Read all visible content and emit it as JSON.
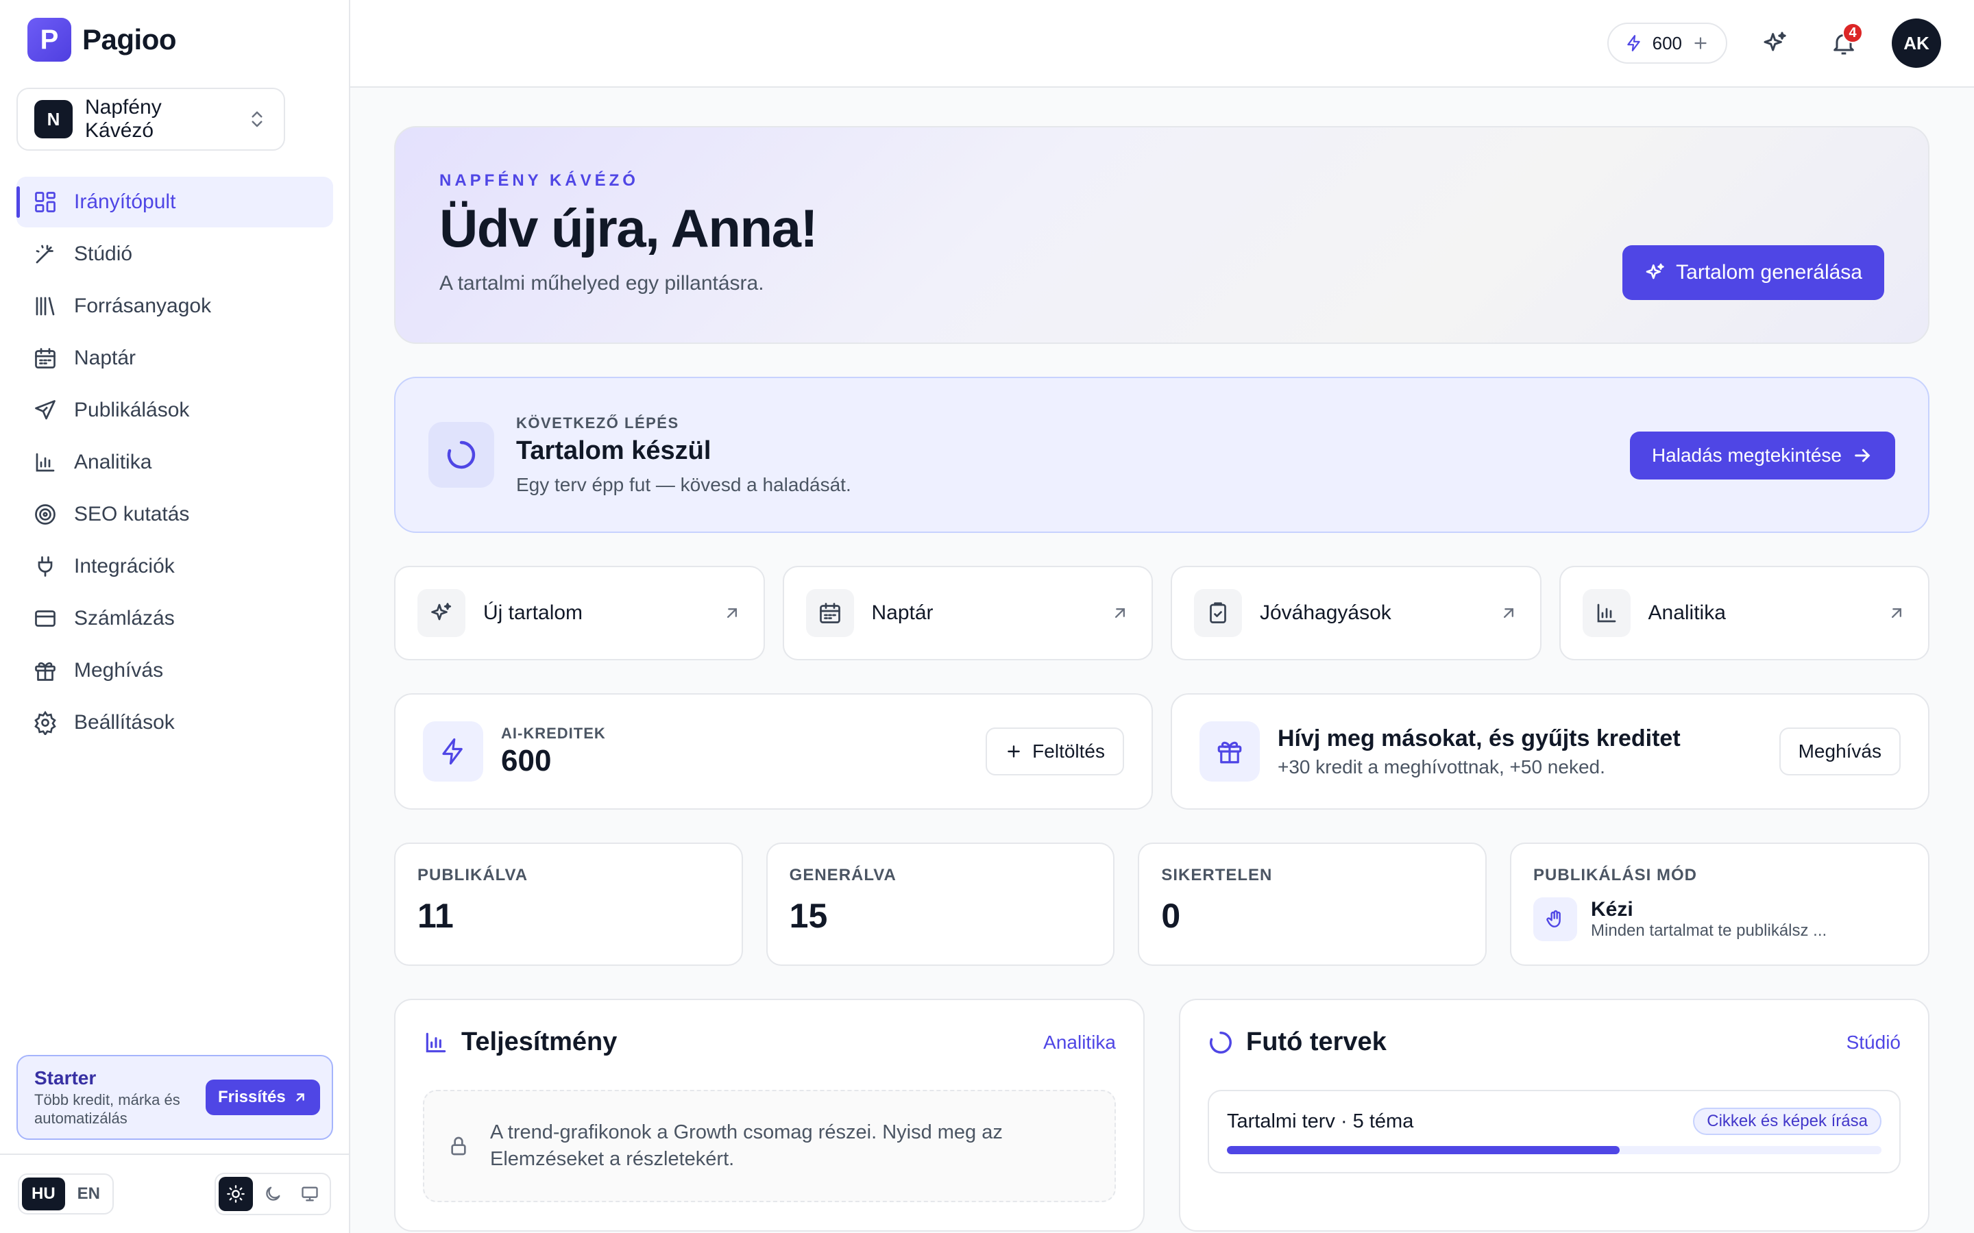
{
  "brand": {
    "logo_letter": "P",
    "name": "Pagioo"
  },
  "workspace": {
    "avatar": "N",
    "name": "Napfény Kávézó"
  },
  "nav": {
    "items": [
      {
        "label": "Irányítópult",
        "icon": "dashboard-icon",
        "active": true
      },
      {
        "label": "Stúdió",
        "icon": "magic-wand-icon"
      },
      {
        "label": "Forrásanyagok",
        "icon": "library-icon"
      },
      {
        "label": "Naptár",
        "icon": "calendar-icon"
      },
      {
        "label": "Publikálások",
        "icon": "send-icon"
      },
      {
        "label": "Analitika",
        "icon": "bar-chart-icon"
      },
      {
        "label": "SEO kutatás",
        "icon": "target-icon"
      },
      {
        "label": "Integrációk",
        "icon": "plug-icon"
      },
      {
        "label": "Számlázás",
        "icon": "credit-card-icon"
      },
      {
        "label": "Meghívás",
        "icon": "gift-icon"
      },
      {
        "label": "Beállítások",
        "icon": "gear-icon"
      }
    ]
  },
  "plan_card": {
    "title": "Starter",
    "description": "Több kredit, márka és automatizálás",
    "button": "Frissítés"
  },
  "footer": {
    "languages": [
      "HU",
      "EN"
    ],
    "active_language": "HU"
  },
  "topbar": {
    "credits": "600",
    "notification_count": "4",
    "user_initials": "AK"
  },
  "hero": {
    "eyebrow": "NAPFÉNY KÁVÉZÓ",
    "title": "Üdv újra, Anna!",
    "subtitle": "A tartalmi műhelyed egy pillantásra.",
    "button": "Tartalom generálása"
  },
  "next_step": {
    "eyebrow": "KÖVETKEZŐ LÉPÉS",
    "title": "Tartalom készül",
    "subtitle": "Egy terv épp fut — kövesd a haladását.",
    "button": "Haladás megtekintése"
  },
  "quick_actions": [
    {
      "label": "Új tartalom",
      "icon": "sparkles-icon"
    },
    {
      "label": "Naptár",
      "icon": "calendar-icon"
    },
    {
      "label": "Jóváhagyások",
      "icon": "clipboard-check-icon"
    },
    {
      "label": "Analitika",
      "icon": "bar-chart-icon"
    }
  ],
  "credits_card": {
    "eyebrow": "AI-KREDITEK",
    "value": "600",
    "button": "Feltöltés"
  },
  "invite_card": {
    "title": "Hívj meg másokat, és gyűjts kreditet",
    "subtitle": "+30 kredit a meghívottnak, +50 neked.",
    "button": "Meghívás"
  },
  "stats": [
    {
      "label": "PUBLIKÁLVA",
      "value": "11"
    },
    {
      "label": "GENERÁLVA",
      "value": "15"
    },
    {
      "label": "SIKERTELEN",
      "value": "0"
    }
  ],
  "publish_mode": {
    "label": "PUBLIKÁLÁSI MÓD",
    "title": "Kézi",
    "subtitle": "Minden tartalmat te publikálsz ..."
  },
  "performance": {
    "title": "Teljesítmény",
    "link": "Analitika",
    "locked_text": "A trend-grafikonok a Growth csomag részei. Nyisd meg az Elemzéseket a részletekért."
  },
  "running_plans": {
    "title": "Futó tervek",
    "link": "Stúdió",
    "plan_name": "Tartalmi terv · 5 téma",
    "plan_status": "Cikkek és képek írása",
    "progress": 0.6
  },
  "colors": {
    "accent": "#4f46e5",
    "badge": "#dc2626",
    "dark": "#111827"
  }
}
